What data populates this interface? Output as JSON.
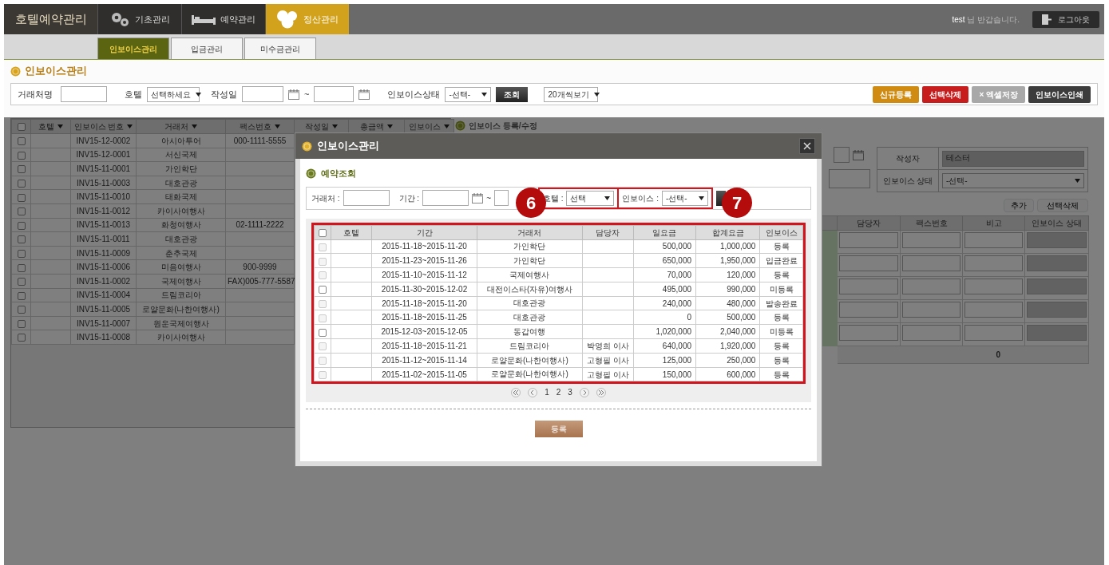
{
  "header": {
    "brand": "호텔예약관리",
    "menus": [
      {
        "label": "기초관리",
        "selected": false
      },
      {
        "label": "예약관리",
        "selected": false
      },
      {
        "label": "정산관리",
        "selected": true
      }
    ],
    "greeting": "**test** 님 반갑습니다.",
    "logout": "로그아웃"
  },
  "sub_tabs": [
    {
      "label": "인보이스관리",
      "selected": true
    },
    {
      "label": "입금관리",
      "selected": false
    },
    {
      "label": "미수금관리",
      "selected": false
    }
  ],
  "page_title": "인보이스관리",
  "filters": {
    "client_label": "거래처명",
    "hotel_label": "호텔",
    "hotel_select": "선택하세요",
    "date_label": "작성일",
    "range_sep": "~",
    "status_label": "인보이스상태",
    "status_select": "-선택-",
    "search_button": "조회",
    "page_size_select": "20개씩보기"
  },
  "actions": [
    {
      "label": "신규등록",
      "color": "#d08c12"
    },
    {
      "label": "선택삭제",
      "color": "#c81d1d"
    },
    {
      "label": "× 엑셀저장",
      "color": "#a8a8a8"
    },
    {
      "label": "인보이스인쇄",
      "color": "#3c3c3c"
    }
  ],
  "invoice_grid": {
    "all_checked": false,
    "columns": [
      "호텔",
      "인보이스 번호",
      "거래처",
      "팩스번호",
      "작성일",
      "총금액",
      "인보이스"
    ],
    "rows": [
      {
        "checked": false,
        "invoice_no": "INV15-12-0002",
        "client": "아시아투어",
        "fax": "000-1111-5555"
      },
      {
        "checked": false,
        "invoice_no": "INV15-12-0001",
        "client": "서신국제"
      },
      {
        "checked": false,
        "invoice_no": "INV15-11-0001",
        "client": "가인학단"
      },
      {
        "checked": false,
        "invoice_no": "INV15-11-0003",
        "client": "대호관광"
      },
      {
        "checked": false,
        "invoice_no": "INV15-11-0010",
        "client": "태화국제"
      },
      {
        "checked": false,
        "invoice_no": "INV15-11-0012",
        "client": "카이사여행사"
      },
      {
        "checked": false,
        "invoice_no": "INV15-11-0013",
        "client": "화청여행사",
        "fax": "02-1111-2222"
      },
      {
        "checked": false,
        "invoice_no": "INV15-11-0011",
        "client": "대호관광"
      },
      {
        "checked": false,
        "invoice_no": "INV15-11-0009",
        "client": "춘추국제"
      },
      {
        "checked": false,
        "invoice_no": "INV15-11-0006",
        "client": "미음여행사",
        "fax": "900-9999"
      },
      {
        "checked": false,
        "invoice_no": "INV15-11-0002",
        "client": "국제여행사",
        "fax": "FAX)005-777-5587"
      },
      {
        "checked": false,
        "invoice_no": "INV15-11-0004",
        "client": "드림코리아"
      },
      {
        "checked": false,
        "invoice_no": "INV15-11-0005",
        "client": "로얄문화(나한여행사)"
      },
      {
        "checked": false,
        "invoice_no": "INV15-11-0007",
        "client": "원운국제여행사"
      },
      {
        "checked": false,
        "invoice_no": "INV15-11-0008",
        "client": "카이사여행사"
      }
    ]
  },
  "edit_panel": {
    "title": "인보이스 등록/수정",
    "writer_label": "작성자",
    "writer": "테스터",
    "status_label": "인보이스 상태",
    "status_select": "-선택-",
    "add_button": "추가",
    "delete_button": "선택삭제",
    "columns": [
      "담당자",
      "팩스번호",
      "비고",
      "인보이스 상태"
    ],
    "total": "0"
  },
  "modal": {
    "title": "인보이스관리",
    "section": "예약조회",
    "filters": {
      "client_label": "거래처 :",
      "period_label": "기간 :",
      "range_sep": "~",
      "hotel_label": "호텔 :",
      "hotel_select": "선택",
      "invoice_label": "인보이스 :",
      "invoice_select": "-선택-"
    },
    "callouts": [
      "6",
      "7"
    ],
    "all_checked": false,
    "columns": [
      "호텔",
      "기간",
      "거래처",
      "담당자",
      "일요금",
      "합계요금",
      "인보이스"
    ],
    "rows": [
      {
        "disabled": true,
        "period": "2015-11-18~2015-11-20",
        "client": "가인학단",
        "daily": "500,000",
        "total": "1,000,000",
        "invoice": "등록"
      },
      {
        "disabled": true,
        "period": "2015-11-23~2015-11-26",
        "client": "가인학단",
        "daily": "650,000",
        "total": "1,950,000",
        "invoice": "입금완료"
      },
      {
        "disabled": true,
        "period": "2015-11-10~2015-11-12",
        "client": "국제여행사",
        "daily": "70,000",
        "total": "120,000",
        "invoice": "등록"
      },
      {
        "disabled": false,
        "period": "2015-11-30~2015-12-02",
        "client": "대전이스타(자유)여행사",
        "daily": "495,000",
        "total": "990,000",
        "invoice": "미등록"
      },
      {
        "disabled": true,
        "period": "2015-11-18~2015-11-20",
        "client": "대호관광",
        "daily": "240,000",
        "total": "480,000",
        "invoice": "발송완료"
      },
      {
        "disabled": true,
        "period": "2015-11-18~2015-11-25",
        "client": "대호관광",
        "daily": "0",
        "total": "500,000",
        "invoice": "등록"
      },
      {
        "disabled": false,
        "period": "2015-12-03~2015-12-05",
        "client": "동갑여행",
        "daily": "1,020,000",
        "total": "2,040,000",
        "invoice": "미등록"
      },
      {
        "disabled": true,
        "period": "2015-11-18~2015-11-21",
        "client": "드림코리아",
        "manager": "박영희 이사",
        "daily": "640,000",
        "total": "1,920,000",
        "invoice": "등록"
      },
      {
        "disabled": true,
        "period": "2015-11-12~2015-11-14",
        "client": "로얄문화(나한여행사)",
        "manager": "고형필 이사",
        "daily": "125,000",
        "total": "250,000",
        "invoice": "등록"
      },
      {
        "disabled": true,
        "period": "2015-11-02~2015-11-05",
        "client": "로얄문화(나한여행사)",
        "manager": "고형필 이사",
        "daily": "150,000",
        "total": "600,000",
        "invoice": "등록"
      }
    ],
    "pages": [
      "1",
      "2",
      "3"
    ],
    "register_button": "등록"
  }
}
